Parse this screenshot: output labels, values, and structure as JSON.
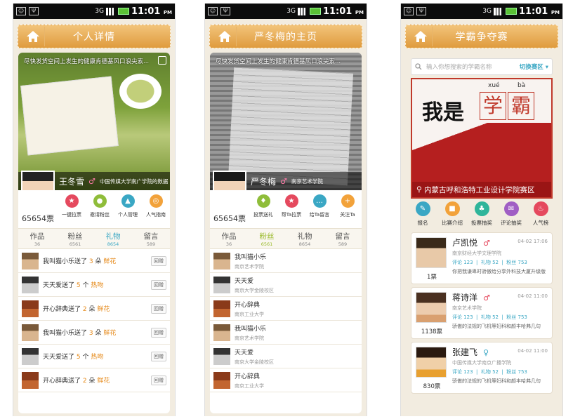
{
  "status": {
    "time": "11:01",
    "ampm": "PM",
    "net": "3G"
  },
  "screen1": {
    "title": "个人详情",
    "caption": "尽快发货空间上发生的健康肯德基风口浪尖索...",
    "name": "王冬雪",
    "gender": "♂",
    "school": "中国传媒大学南广学院的数据",
    "votes": "65654票",
    "actions": [
      {
        "label": "一键拉票",
        "color": "#e5495e",
        "icon": "pin-icon"
      },
      {
        "label": "邀请粉丝",
        "color": "#8fbd3a",
        "icon": "people-icon"
      },
      {
        "label": "个人管理",
        "color": "#3aa7c4",
        "icon": "user-icon"
      },
      {
        "label": "人气指南",
        "color": "#f2a23a",
        "icon": "compass-icon"
      }
    ],
    "tabs": [
      {
        "label": "作品",
        "count": "36"
      },
      {
        "label": "粉丝",
        "count": "6561"
      },
      {
        "label": "礼物",
        "count": "8654"
      },
      {
        "label": "留言",
        "count": "589"
      }
    ],
    "gifts": [
      {
        "user": "我叫猫小乐送了",
        "num": "3",
        "unit": "朵",
        "gift": "鲜花",
        "reply": "回赠"
      },
      {
        "user": "天天爱送了",
        "num": "5",
        "unit": "个",
        "gift": "热吻",
        "reply": "回赠"
      },
      {
        "user": "开心辞典送了",
        "num": "2",
        "unit": "朵",
        "gift": "鲜花",
        "reply": "回赠"
      },
      {
        "user": "我叫猫小乐送了",
        "num": "3",
        "unit": "朵",
        "gift": "鲜花",
        "reply": "回赠"
      },
      {
        "user": "天天爱送了",
        "num": "5",
        "unit": "个",
        "gift": "热吻",
        "reply": "回赠"
      },
      {
        "user": "开心辞典送了",
        "num": "2",
        "unit": "朵",
        "gift": "鲜花",
        "reply": "回赠"
      }
    ]
  },
  "screen2": {
    "title": "严冬梅的主页",
    "caption": "尽快发货空间上发生的健康肯德基风口浪尖索...",
    "name": "严冬梅",
    "gender": "♂",
    "school": "南京艺术学院",
    "votes": "65654票",
    "actions": [
      {
        "label": "投票送礼",
        "color": "#8fbd3a",
        "icon": "gift-icon"
      },
      {
        "label": "帮Ta拉票",
        "color": "#e5495e",
        "icon": "pin-icon"
      },
      {
        "label": "给Ta留言",
        "color": "#3aa7c4",
        "icon": "chat-icon"
      },
      {
        "label": "关注Ta",
        "color": "#f2a23a",
        "icon": "plus-icon"
      }
    ],
    "tabs": [
      {
        "label": "作品",
        "count": "36"
      },
      {
        "label": "粉丝",
        "count": "6561"
      },
      {
        "label": "礼物",
        "count": "8654"
      },
      {
        "label": "留言",
        "count": "589"
      }
    ],
    "fans": [
      {
        "name": "我叫猫小乐",
        "school": "南京艺术学院"
      },
      {
        "name": "天天爱",
        "school": "南京大学金陵校区"
      },
      {
        "name": "开心辞典",
        "school": "南京工业大学"
      },
      {
        "name": "我叫猫小乐",
        "school": "南京艺术学院"
      },
      {
        "name": "天天爱",
        "school": "南京大学金陵校区"
      },
      {
        "name": "开心辞典",
        "school": "南京工业大学"
      }
    ]
  },
  "screen3": {
    "title": "学霸争夺赛",
    "search_placeholder": "输入你想搜索的学霸名称",
    "switch_label": "切换赛区",
    "poster": {
      "text": "我是",
      "char1": "学",
      "char2": "霸",
      "py1": "xué",
      "py2": "bà",
      "location": "内蒙古呼和浩特工业设计学院赛区"
    },
    "cats": [
      {
        "label": "报名",
        "color": "#3aa7c4",
        "icon": "signup-icon"
      },
      {
        "label": "比赛介绍",
        "color": "#f2a23a",
        "icon": "intro-icon"
      },
      {
        "label": "投票抽奖",
        "color": "#2fb59a",
        "icon": "lottery-icon"
      },
      {
        "label": "评论抽奖",
        "color": "#a05ec4",
        "icon": "comment-icon"
      },
      {
        "label": "人气榜",
        "color": "#e5495e",
        "icon": "fire-icon"
      }
    ],
    "users": [
      {
        "name": "卢凯悦",
        "gender": "♂",
        "gcolor": "#e5495e",
        "date": "04-02 17:06",
        "school": "南京财经大学文理学院",
        "comments": "评论 123",
        "gifts": "礼物 52",
        "fans": "粉丝 753",
        "desc": "你把我谦卑时骄傲给分享外科技大厦升级版",
        "votes": "1票"
      },
      {
        "name": "蒋诗洋",
        "gender": "♂",
        "gcolor": "#e5495e",
        "date": "04-02 11:00",
        "school": "南京艺术学院",
        "comments": "评论 123",
        "gifts": "礼物 52",
        "fans": "粉丝 753",
        "desc": "骄傲的法规的飞机等妇科和颜丰哈弗几句",
        "votes": "1138票"
      },
      {
        "name": "张建飞",
        "gender": "♀",
        "gcolor": "#3aa7c4",
        "date": "04-02 11:00",
        "school": "中国传媒大学南京广播学院",
        "comments": "评论 123",
        "gifts": "礼物 52",
        "fans": "粉丝 753",
        "desc": "骄傲的法规的飞机等妇科和颜丰哈弗几句",
        "votes": "830票"
      }
    ]
  }
}
